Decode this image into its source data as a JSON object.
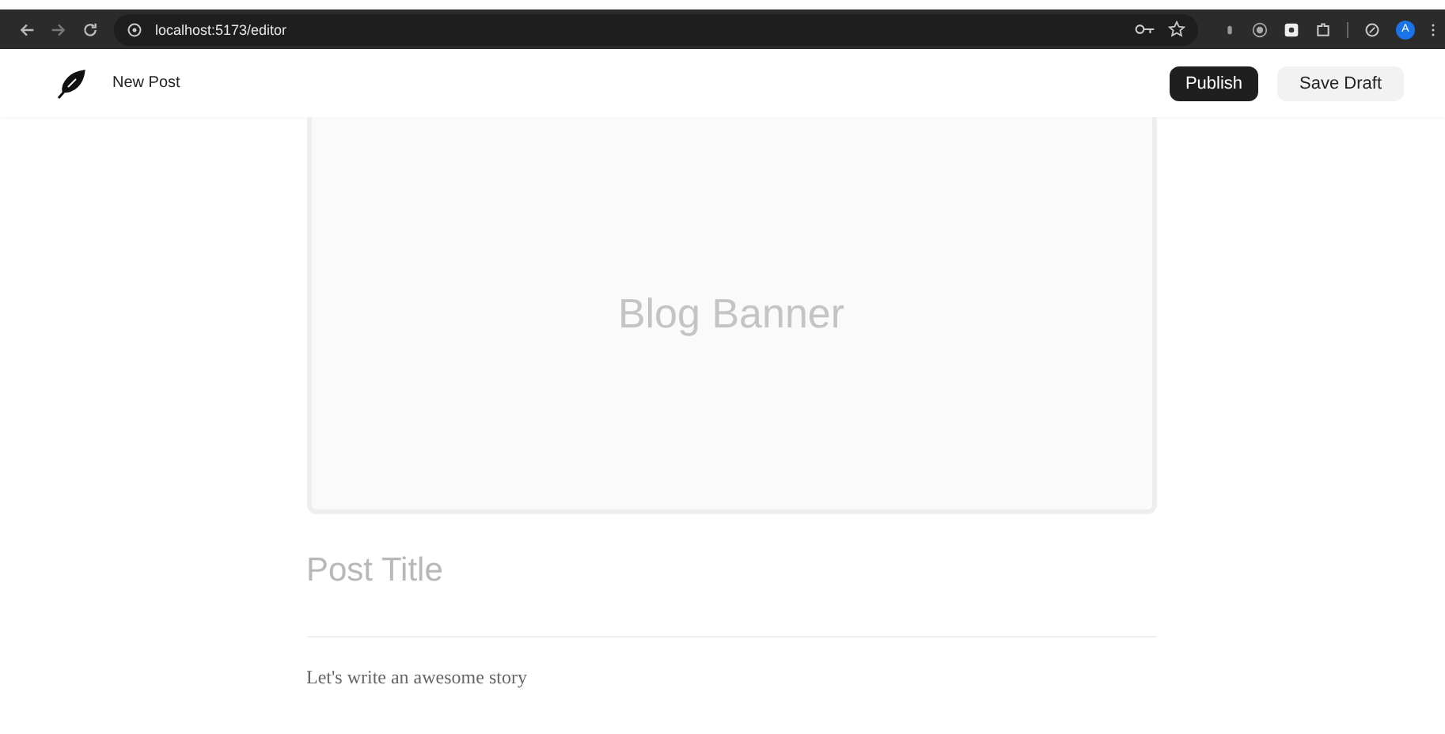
{
  "browser": {
    "url": "localhost:5173/editor",
    "avatar": "A"
  },
  "header": {
    "title": "New Post",
    "buttons": [
      {
        "label": "Publish",
        "kind": "primary"
      },
      {
        "label": "Save Draft",
        "kind": "secondary"
      }
    ]
  },
  "editor": {
    "banner": "Blog Banner",
    "title_placeholder": "Post Title",
    "body_placeholder": "Let's write an awesome story"
  }
}
